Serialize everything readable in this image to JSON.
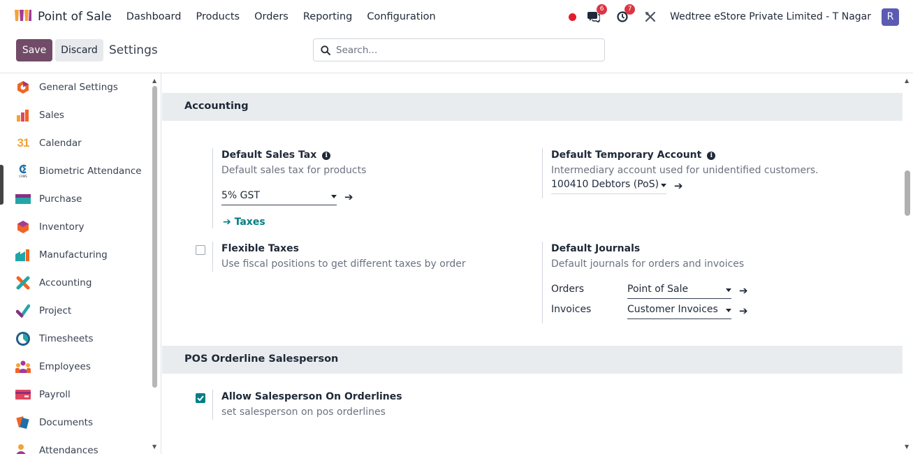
{
  "navbar": {
    "app_title": "Point of Sale",
    "menu": [
      "Dashboard",
      "Products",
      "Orders",
      "Reporting",
      "Configuration"
    ],
    "messages_count": "6",
    "activities_count": "7",
    "company": "Wedtree eStore Private Limited - T Nagar",
    "avatar_initial": "R"
  },
  "control_panel": {
    "save_label": "Save",
    "discard_label": "Discard",
    "title": "Settings",
    "search_placeholder": "Search..."
  },
  "sidebar": {
    "items": [
      {
        "label": "General Settings",
        "icon": "general-settings-icon"
      },
      {
        "label": "Sales",
        "icon": "sales-icon"
      },
      {
        "label": "Calendar",
        "icon": "calendar-icon"
      },
      {
        "label": "Biometric Attendance",
        "icon": "biometric-icon"
      },
      {
        "label": "Purchase",
        "icon": "purchase-icon"
      },
      {
        "label": "Inventory",
        "icon": "inventory-icon"
      },
      {
        "label": "Manufacturing",
        "icon": "manufacturing-icon"
      },
      {
        "label": "Accounting",
        "icon": "accounting-icon"
      },
      {
        "label": "Project",
        "icon": "project-icon"
      },
      {
        "label": "Timesheets",
        "icon": "timesheets-icon"
      },
      {
        "label": "Employees",
        "icon": "employees-icon"
      },
      {
        "label": "Payroll",
        "icon": "payroll-icon"
      },
      {
        "label": "Documents",
        "icon": "documents-icon"
      },
      {
        "label": "Attendances",
        "icon": "attendances-icon"
      }
    ],
    "calendar_icon_text": "31",
    "biometric_icon_text": "CAMS"
  },
  "accounting": {
    "section_title": "Accounting",
    "default_sales_tax": {
      "title": "Default Sales Tax",
      "description": "Default sales tax for products",
      "value": "5% GST",
      "link": "Taxes"
    },
    "default_temp_account": {
      "title": "Default Temporary Account",
      "description": "Intermediary account used for unidentified customers.",
      "value": "100410 Debtors (PoS)"
    },
    "flexible_taxes": {
      "title": "Flexible Taxes",
      "description": "Use fiscal positions to get different taxes by order",
      "checked": false
    },
    "default_journals": {
      "title": "Default Journals",
      "description": "Default journals for orders and invoices",
      "orders_label": "Orders",
      "orders_value": "Point of Sale",
      "invoices_label": "Invoices",
      "invoices_value": "Customer Invoices"
    }
  },
  "salesperson": {
    "section_title": "POS Orderline Salesperson",
    "allow": {
      "title": "Allow Salesperson On Orderlines",
      "description": "set salesperson on pos orderlines",
      "checked": true
    }
  },
  "colors": {
    "brand": "#714b67",
    "accent": "#017e84",
    "badge": "#dc3545"
  }
}
